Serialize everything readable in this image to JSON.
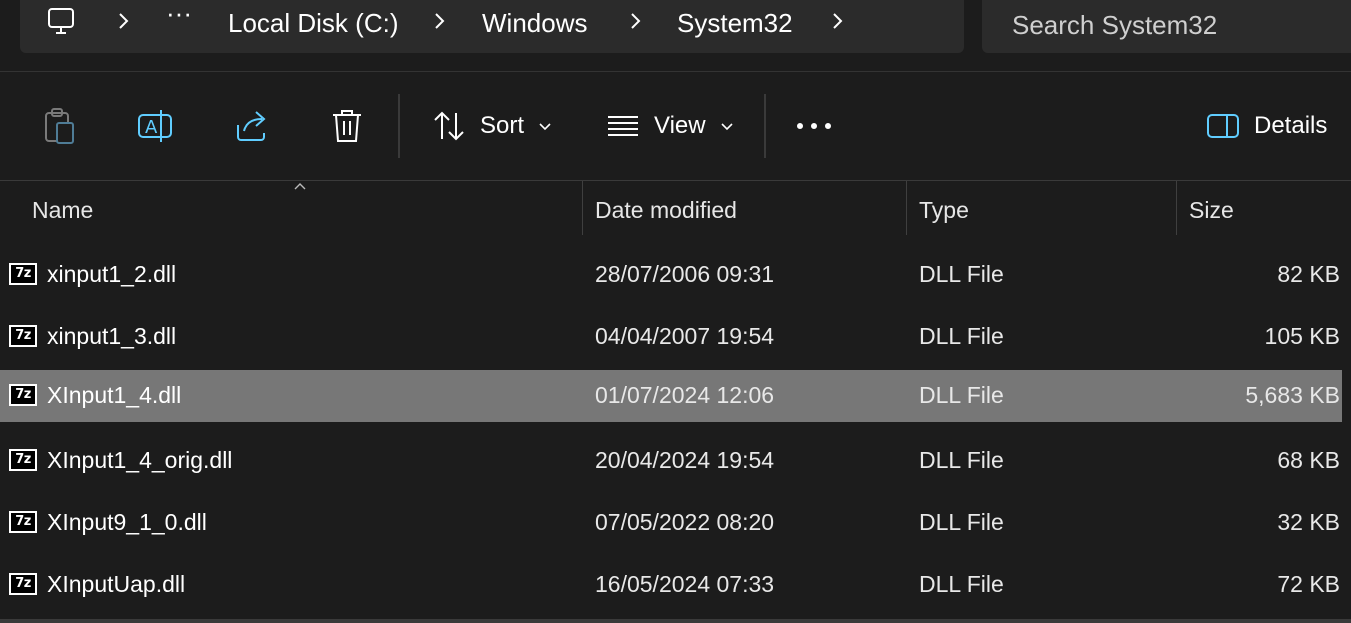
{
  "breadcrumb": {
    "overflow_label": "···",
    "items": [
      "Local Disk (C:)",
      "Windows",
      "System32"
    ]
  },
  "search": {
    "placeholder": "Search System32"
  },
  "toolbar": {
    "sort_label": "Sort",
    "view_label": "View",
    "details_label": "Details"
  },
  "columns": {
    "name": "Name",
    "date": "Date modified",
    "type": "Type",
    "size": "Size"
  },
  "files": [
    {
      "icon": "7z-file-icon",
      "icon_text": "7z",
      "name": "xinput1_2.dll",
      "date": "28/07/2006 09:31",
      "type": "DLL File",
      "size": "82 KB",
      "selected": false
    },
    {
      "icon": "7z-file-icon",
      "icon_text": "7z",
      "name": "xinput1_3.dll",
      "date": "04/04/2007 19:54",
      "type": "DLL File",
      "size": "105 KB",
      "selected": false
    },
    {
      "icon": "7z-file-icon",
      "icon_text": "7z",
      "name": "XInput1_4.dll",
      "date": "01/07/2024 12:06",
      "type": "DLL File",
      "size": "5,683 KB",
      "selected": true
    },
    {
      "icon": "7z-file-icon",
      "icon_text": "7z",
      "name": "XInput1_4_orig.dll",
      "date": "20/04/2024 19:54",
      "type": "DLL File",
      "size": "68 KB",
      "selected": false
    },
    {
      "icon": "7z-file-icon",
      "icon_text": "7z",
      "name": "XInput9_1_0.dll",
      "date": "07/05/2022 08:20",
      "type": "DLL File",
      "size": "32 KB",
      "selected": false
    },
    {
      "icon": "7z-file-icon",
      "icon_text": "7z",
      "name": "XInputUap.dll",
      "date": "16/05/2024 07:33",
      "type": "DLL File",
      "size": "72 KB",
      "selected": false
    }
  ],
  "colors": {
    "background": "#1c1c1c",
    "selected_row": "#777777",
    "accent_icon": "#60cdff"
  }
}
